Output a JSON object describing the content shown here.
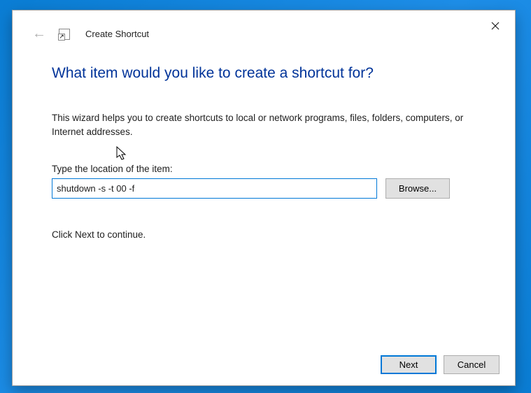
{
  "window": {
    "title": "Create Shortcut"
  },
  "heading": "What item would you like to create a shortcut for?",
  "description": "This wizard helps you to create shortcuts to local or network programs, files, folders, computers, or Internet addresses.",
  "field": {
    "label": "Type the location of the item:",
    "value": "shutdown -s -t 00 -f"
  },
  "buttons": {
    "browse": "Browse...",
    "next": "Next",
    "cancel": "Cancel"
  },
  "continue_text": "Click Next to continue."
}
